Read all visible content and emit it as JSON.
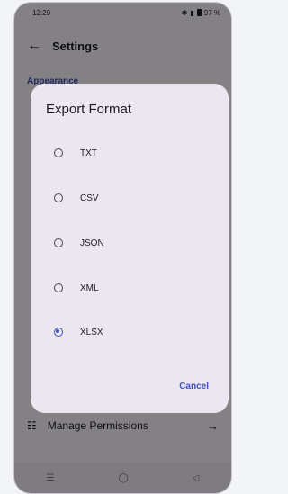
{
  "status": {
    "time": "12:29",
    "battery": "97 %"
  },
  "app": {
    "title": "Settings"
  },
  "section": {
    "appearance": "Appearance"
  },
  "settings_rows": {
    "manage_permissions": "Manage Permissions"
  },
  "dialog": {
    "title": "Export Format",
    "options": [
      "TXT",
      "CSV",
      "JSON",
      "XML",
      "XLSX"
    ],
    "selected": "XLSX",
    "cancel": "Cancel"
  }
}
